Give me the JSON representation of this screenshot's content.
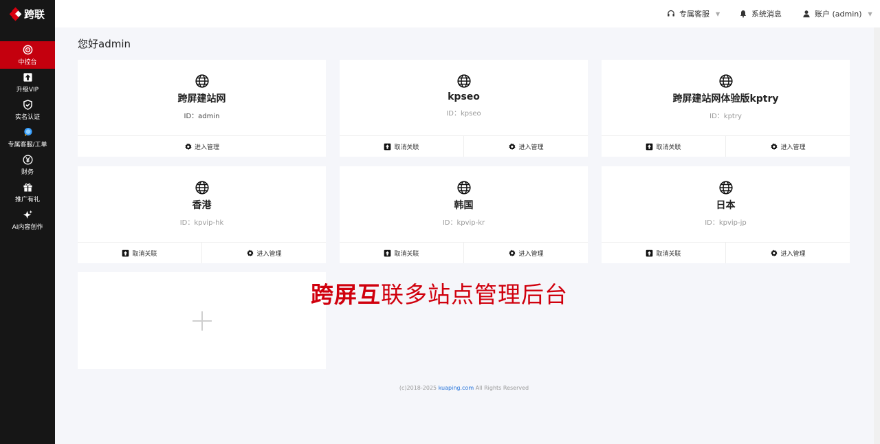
{
  "app": {
    "logo_text": "跨联"
  },
  "sidebar": {
    "items": [
      {
        "label": "中控台",
        "icon": "target-icon",
        "active": true
      },
      {
        "label": "升级VIP",
        "icon": "upgrade-icon",
        "active": false
      },
      {
        "label": "实名认证",
        "icon": "shield-icon",
        "active": false
      },
      {
        "label": "专属客服/工单",
        "icon": "support-bubble-icon",
        "active": false
      },
      {
        "label": "财务",
        "icon": "yen-icon",
        "active": false
      },
      {
        "label": "推广有礼",
        "icon": "gift-icon",
        "active": false
      },
      {
        "label": "AI内容创作",
        "icon": "sparkle-icon",
        "active": false
      }
    ]
  },
  "topbar": {
    "support_label": "专属客服",
    "messages_label": "系统消息",
    "account_label": "账户 (admin)"
  },
  "main": {
    "greeting": "您好admin",
    "sites": [
      {
        "title": "跨屏建站网",
        "id_text": "ID：admin",
        "unlink_label": "",
        "manage_label": "进入管理"
      },
      {
        "title": "kpseo",
        "id_text": "ID：kpseo",
        "unlink_label": "取消关联",
        "manage_label": "进入管理"
      },
      {
        "title": "跨屏建站网体验版kptry",
        "id_text": "ID：kptry",
        "unlink_label": "取消关联",
        "manage_label": "进入管理"
      },
      {
        "title": "香港",
        "id_text": "ID：kpvip-hk",
        "unlink_label": "取消关联",
        "manage_label": "进入管理"
      },
      {
        "title": "韩国",
        "id_text": "ID：kpvip-kr",
        "unlink_label": "取消关联",
        "manage_label": "进入管理"
      },
      {
        "title": "日本",
        "id_text": "ID：kpvip-jp",
        "unlink_label": "取消关联",
        "manage_label": "进入管理"
      }
    ],
    "banner_bold": "跨屏互",
    "banner_rest": "联多站点管理后台"
  },
  "footer": {
    "prefix": "(c)2018-2025 ",
    "link": "kuaping.com",
    "suffix": " All Rights Reserved"
  },
  "colors": {
    "sidebar_bg": "#161616",
    "accent": "#c4000e",
    "page_bg": "#f5f6fa",
    "link": "#1e6fd9"
  }
}
